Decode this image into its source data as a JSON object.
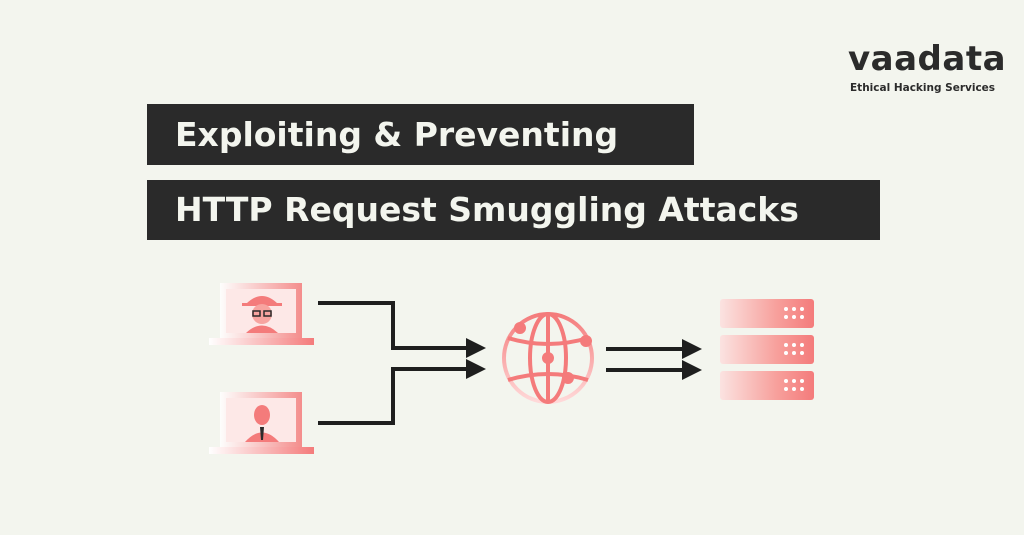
{
  "logo": {
    "wordmark": "vaadata",
    "tagline": "Ethical Hacking Services"
  },
  "title": {
    "line1": "Exploiting & Preventing",
    "line2": "HTTP Request Smuggling Attacks"
  },
  "colors": {
    "background": "#f3f5ee",
    "dark": "#2a2a2a",
    "accent": "#f47b7b"
  },
  "icons": [
    "hacker-laptop-icon",
    "user-laptop-icon",
    "globe-proxy-icon",
    "server-stack-icon"
  ]
}
